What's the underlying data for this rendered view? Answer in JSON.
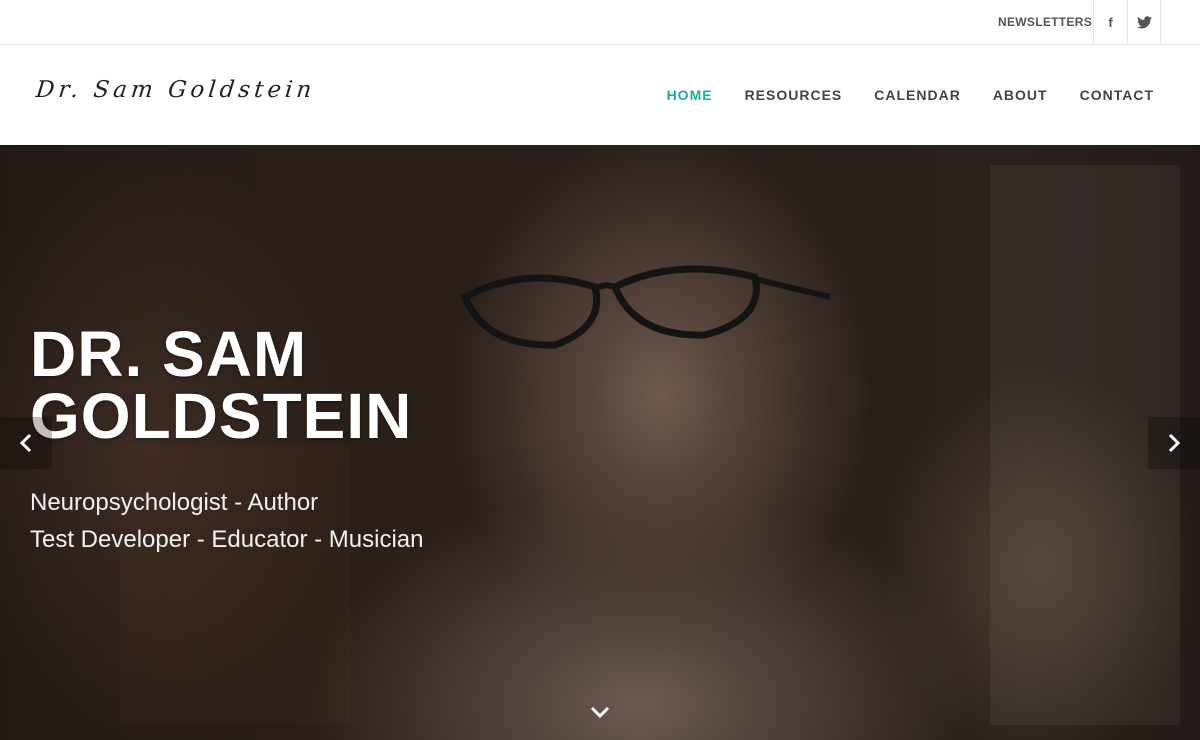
{
  "topbar": {
    "newsletters_label": "NEWSLETTERS",
    "social": [
      {
        "icon": "facebook-icon",
        "glyph": "f"
      },
      {
        "icon": "twitter-icon"
      }
    ]
  },
  "header": {
    "logo_text": "Dr. Sam Goldstein",
    "nav": [
      {
        "label": "HOME",
        "active": true
      },
      {
        "label": "RESOURCES",
        "active": false
      },
      {
        "label": "CALENDAR",
        "active": false
      },
      {
        "label": "ABOUT",
        "active": false
      },
      {
        "label": "CONTACT",
        "active": false
      }
    ]
  },
  "hero": {
    "title_line1": "DR. SAM",
    "title_line2": "GOLDSTEIN",
    "subtitle_line1": "Neuropsychologist - Author",
    "subtitle_line2": "Test Developer - Educator - Musician",
    "prev_icon": "chevron-left-icon",
    "next_icon": "chevron-right-icon",
    "scroll_icon": "chevron-down-icon"
  },
  "colors": {
    "accent": "#1aaf9f",
    "nav_text": "#444444",
    "hero_text": "#ffffff"
  }
}
